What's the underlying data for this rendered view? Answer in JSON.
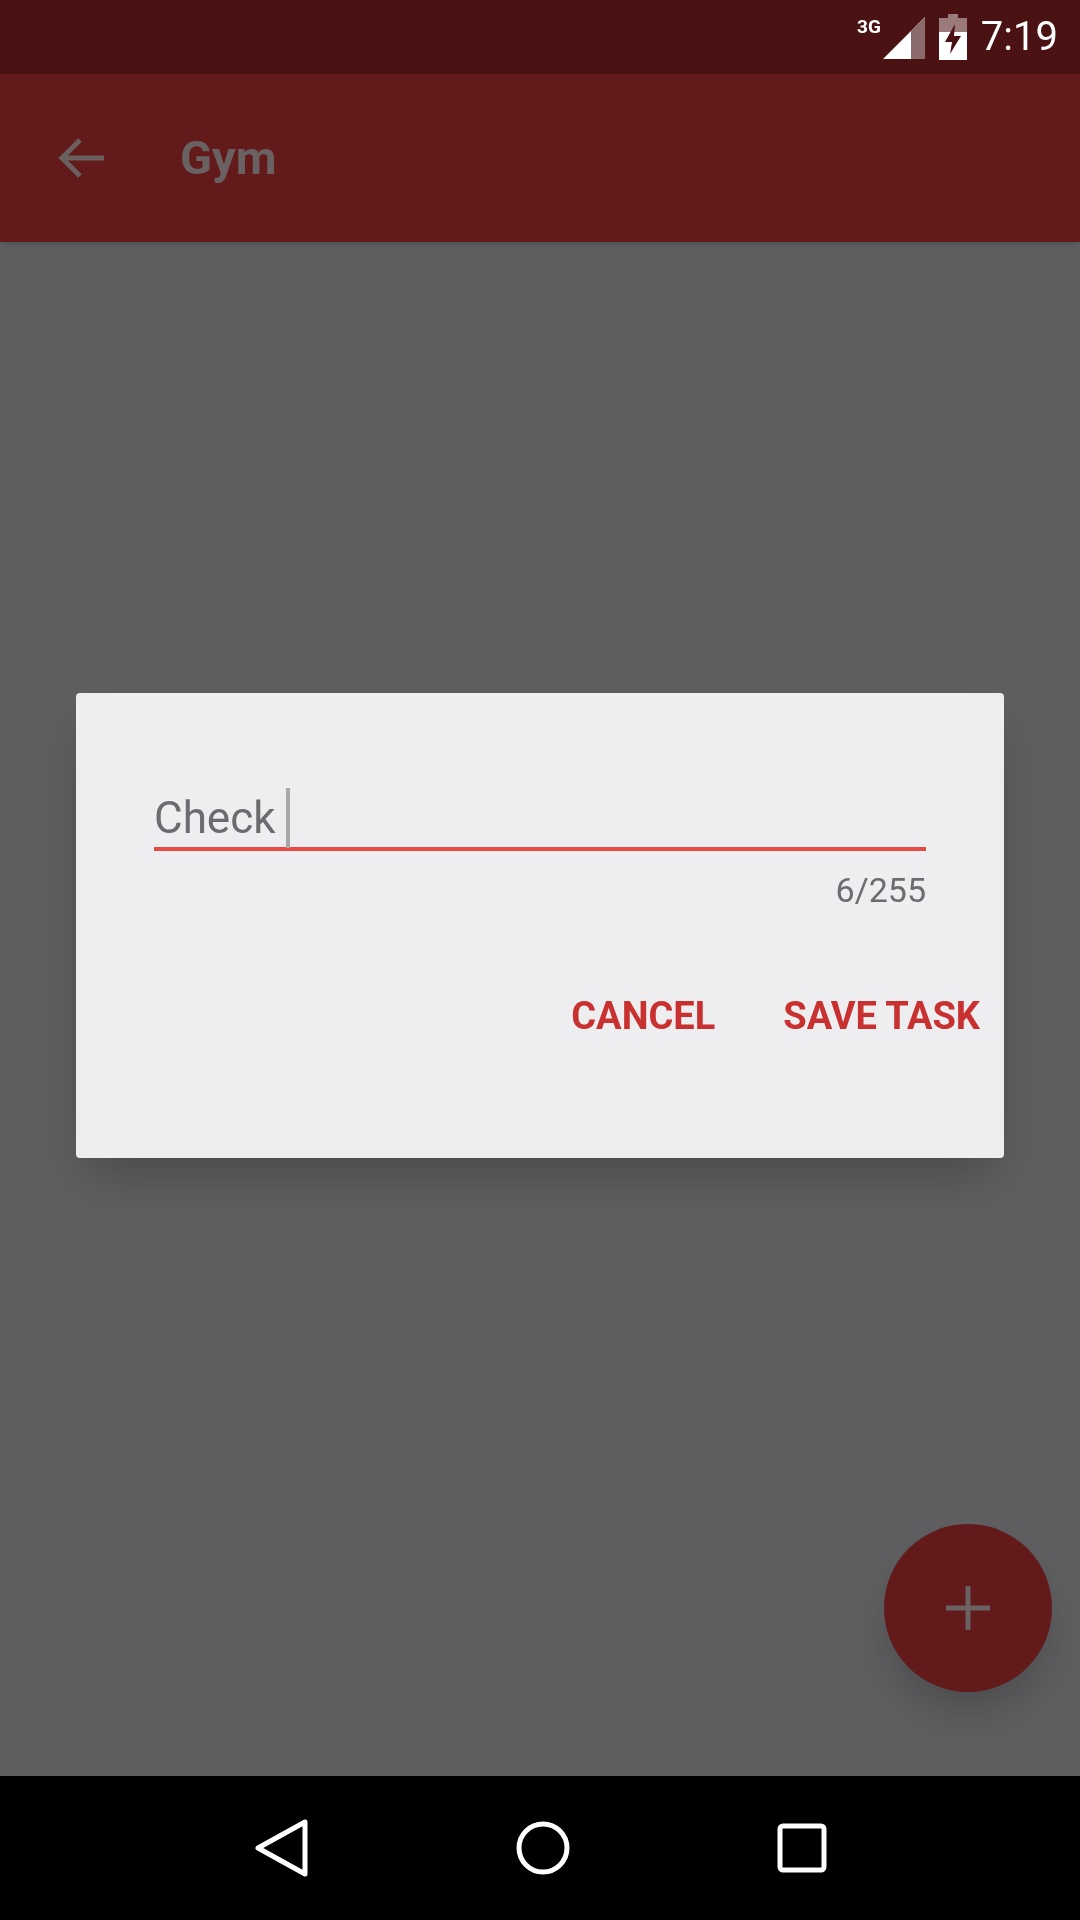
{
  "status_bar": {
    "network": "3G",
    "time": "7:19"
  },
  "app_bar": {
    "title": "Gym"
  },
  "dialog": {
    "field": {
      "value": "Check",
      "counter": "6/255",
      "focused": true
    },
    "buttons": [
      "CANCEL",
      "SAVE TASK"
    ]
  }
}
